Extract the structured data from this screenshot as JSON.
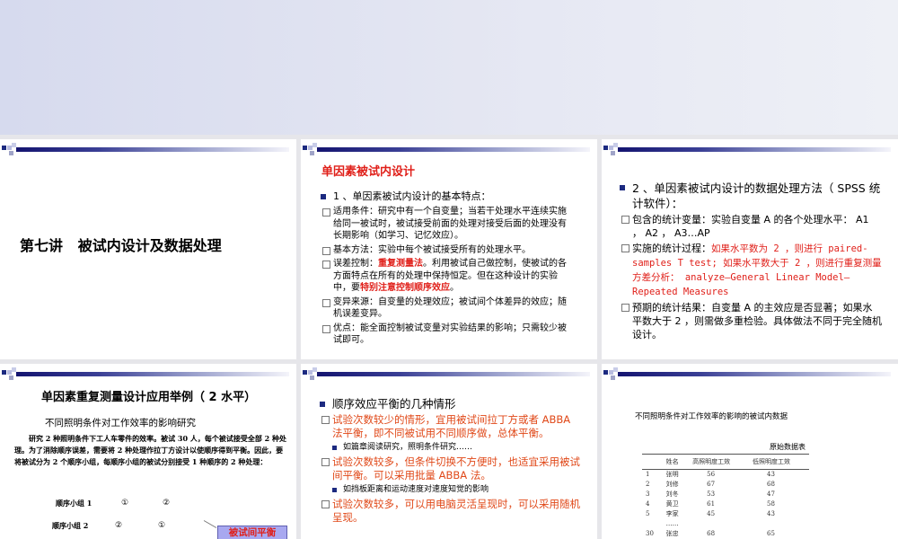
{
  "slides": {
    "s1": {
      "title": "第七讲   被试内设计及数据处理"
    },
    "s2": {
      "title": "单因素被试内设计",
      "heading": "1 、单因素被试内设计的基本特点：",
      "items": [
        {
          "text": "适用条件：研究中有一个自变量；当若干处理水平连续实施给同一被试时，被试接受前面的处理对接受后面的处理没有长期影响（如学习、记忆效应）。"
        },
        {
          "text": "基本方法：实验中每个被试接受所有的处理水平。"
        },
        {
          "pre": "误差控制：",
          "red1": "重复测量法",
          "mid": "。利用被试自己做控制，使被试的各方面特点在所有的处理中保持恒定。但在这种设计的实验中，要",
          "red2": "特别注意控制顺序效应",
          "post": "。"
        },
        {
          "text": "变异来源：自变量的处理效应；被试间个体差异的效应；随机误差变异。"
        },
        {
          "text": "优点：能全面控制被试变量对实验结果的影响；只需较少被试即可。"
        }
      ]
    },
    "s3": {
      "heading": "2 、单因素被试内设计的数据处理方法（ SPSS 统计软件）：",
      "item1": "包含的统计变量：实验自变量 A 的各个处理水平： A1 ， A2 ， A3…AP",
      "item2_pre": "实施的统计过程：",
      "item2_red": "如果水平数为 2 ，则进行 paired-samples T test; 如果水平数大于 2 ，则进行重复测量方差分析： analyze—General Linear Model—Repeated Measures",
      "item3": "预期的统计结果：自变量 A 的主效应是否显著；如果水平数大于 2 ，则需做多重检验。具体做法不同于完全随机设计。"
    },
    "s4": {
      "title": "单因素重复测量设计应用举例（ 2 水平）",
      "subtitle": "不同照明条件对工作效率的影响研究",
      "body": "研究 2 种照明条件下工人车零件的效率。被试 30 人，每个被试接受全部 2 种处理。为了消除顺序误差，需要将 2 种处理作拉丁方设计以使顺序得到平衡。因此，要将被试分为 2 个顺序小组，每顺序小组的被试分别接受 1 种顺序的 2 种处理：",
      "group1": "顺序小组 1",
      "g1a": "①",
      "g1b": "②",
      "group2": "顺序小组 2",
      "g2a": "②",
      "g2b": "①",
      "callout": "被试间平衡"
    },
    "s5": {
      "heading": "顺序效应平衡的几种情形",
      "i1": "试验次数较少的情形，宜用被试间拉丁方或者 ABBA 法平衡，即不同被试用不同顺序做，总体平衡。",
      "i1s": "如篇章阅读研究，照明条件研究……",
      "i2": "试验次数较多，但条件切换不方便时，也适宜采用被试间平衡。可以采用批量 ABBA 法。",
      "i2s": "如挡板距离和运动速度对速度知觉的影响",
      "i3": "试验次数较多，可以用电脑灵活呈现时，可以采用随机呈现。"
    },
    "s6": {
      "title": "不同照明条件对工作效率的影响的被试内数据",
      "caption": "原始数据表",
      "headers": [
        "",
        "姓名",
        "高照明度工效",
        "低照明度工效"
      ],
      "rows": [
        [
          "1",
          "张明",
          "56",
          "43"
        ],
        [
          "2",
          "刘修",
          "67",
          "68"
        ],
        [
          "3",
          "刘冬",
          "53",
          "47"
        ],
        [
          "4",
          "黄卫",
          "61",
          "58"
        ],
        [
          "5",
          "李家",
          "45",
          "43"
        ],
        [
          "",
          "……",
          "",
          ""
        ],
        [
          "30",
          "张忠",
          "68",
          "65"
        ]
      ]
    }
  }
}
